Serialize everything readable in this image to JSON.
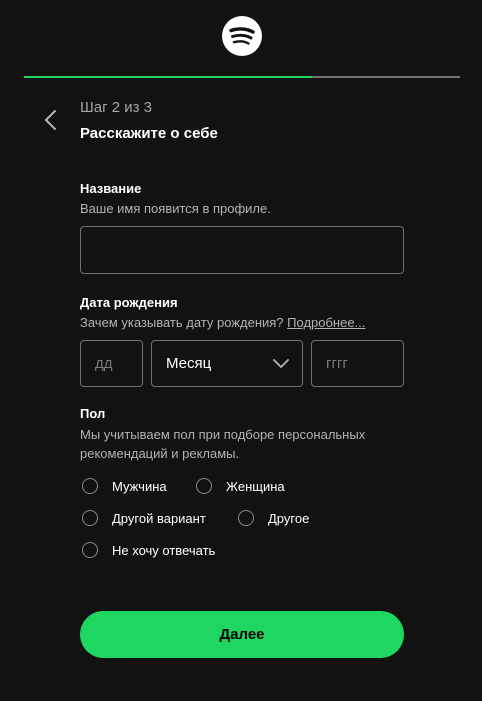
{
  "progress": 0.66,
  "step": {
    "counter": "Шаг 2 из 3",
    "title": "Расскажите о себе"
  },
  "name_section": {
    "label": "Название",
    "hint": "Ваше имя появится в профиле.",
    "value": ""
  },
  "birth_section": {
    "label": "Дата рождения",
    "hint": "Зачем указывать дату рождения?",
    "link": "Подробнее...",
    "day_placeholder": "дд",
    "month_selected": "Месяц",
    "year_placeholder": "гггг"
  },
  "gender_section": {
    "label": "Пол",
    "hint_line1": "Мы учитываем пол при подборе персональных",
    "hint_line2": "рекомендаций и рекламы.",
    "options": [
      "Мужчина",
      "Женщина",
      "Другой вариант",
      "Другое",
      "Не хочу отвечать"
    ]
  },
  "next_button": "Далее",
  "colors": {
    "accent": "#1ed760",
    "background": "#121212",
    "border": "#727272"
  }
}
